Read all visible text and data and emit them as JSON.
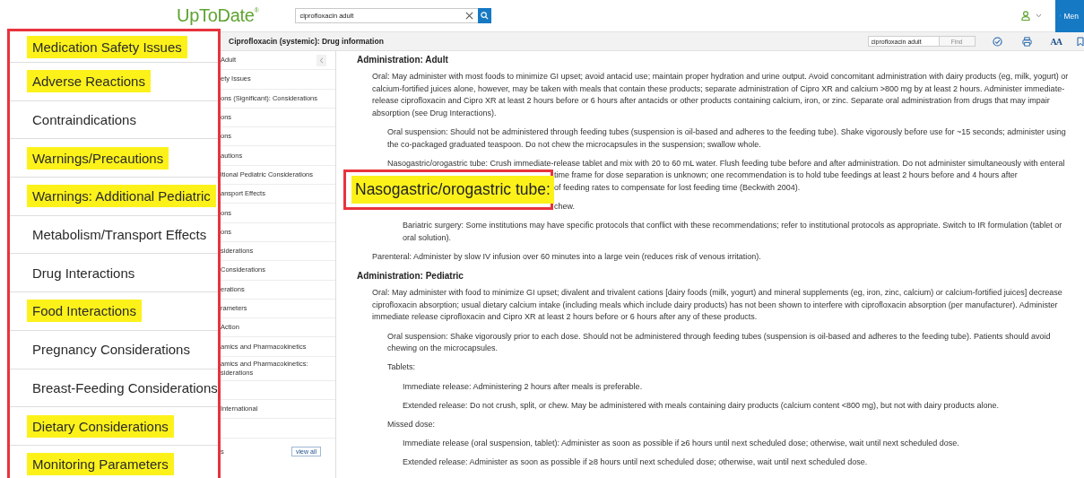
{
  "header": {
    "logo": "UpToDate",
    "logo_mark": "®",
    "search": {
      "value": "ciprofloxacin adult"
    },
    "menu_label": "Men"
  },
  "title_bar": {
    "title": "Ciprofloxacin (systemic): Drug information",
    "find_field": {
      "value": "ciprofloxacin adult"
    },
    "find_button": "Find",
    "font_button": "AA"
  },
  "sidebar": {
    "items": [
      {
        "kind": "link",
        "label": "Adult"
      },
      {
        "kind": "link",
        "label": "ety Issues"
      },
      {
        "kind": "link",
        "label": "ons (Significant): Considerations"
      },
      {
        "kind": "link",
        "label": "ons"
      },
      {
        "kind": "link",
        "label": "ons"
      },
      {
        "kind": "link",
        "label": "autions"
      },
      {
        "kind": "link",
        "label": "itional Pediatric Considerations"
      },
      {
        "kind": "link",
        "label": "ansport Effects"
      },
      {
        "kind": "link",
        "label": "ons"
      },
      {
        "kind": "link",
        "label": "ons"
      },
      {
        "kind": "link",
        "label": "siderations"
      },
      {
        "kind": "link",
        "label": "Considerations"
      },
      {
        "kind": "link",
        "label": "erations"
      },
      {
        "kind": "link",
        "label": "rameters"
      },
      {
        "kind": "link",
        "label": "Action"
      },
      {
        "kind": "link",
        "label": "amics and Pharmacokinetics"
      },
      {
        "kind": "link",
        "label": "amics and Pharmacokinetics: siderations"
      },
      {
        "kind": "blank"
      },
      {
        "kind": "link",
        "label": "International"
      },
      {
        "kind": "blank"
      }
    ],
    "footer_label": "s",
    "view_all": "view all"
  },
  "overlay": {
    "items": [
      {
        "label": "Medication Safety Issues",
        "highlighted": true
      },
      {
        "label": "Adverse Reactions",
        "highlighted": true
      },
      {
        "label": "Contraindications",
        "highlighted": false
      },
      {
        "label": "Warnings/Precautions",
        "highlighted": true
      },
      {
        "label": "Warnings: Additional Pediatric",
        "highlighted": true
      },
      {
        "label": "Metabolism/Transport Effects",
        "highlighted": false
      },
      {
        "label": "Drug Interactions",
        "highlighted": false
      },
      {
        "label": "Food Interactions",
        "highlighted": true
      },
      {
        "label": "Pregnancy Considerations",
        "highlighted": false
      },
      {
        "label": "Breast-Feeding Considerations",
        "highlighted": false
      },
      {
        "label": "Dietary Considerations",
        "highlighted": true
      },
      {
        "label": "Monitoring Parameters",
        "highlighted": true
      }
    ]
  },
  "callout": {
    "label": "Nasogastric/orogastric tube:"
  },
  "content": {
    "sections": [
      {
        "heading": "Administration: Adult",
        "nodes": [
          {
            "kind": "text",
            "text": "Oral: May administer with most foods to minimize GI upset; avoid antacid use; maintain proper hydration and urine output. Avoid concomitant administration with dairy products (eg, milk, yogurt) or calcium-fortified juices alone, however, may be taken with meals that contain these products; separate administration of Cipro XR and calcium >800 mg by at least 2 hours. Administer immediate-release ciprofloxacin and Cipro XR at least 2 hours before or 6 hours after antacids or other products containing calcium, iron, or zinc. Separate oral administration from drugs that may impair absorption (see Drug Interactions).",
            "children": [
              {
                "kind": "text",
                "text": "Oral suspension: Should not be administered through feeding tubes (suspension is oil-based and adheres to the feeding tube). Shake vigorously before use for ~15 seconds; administer using the co-packaged graduated teaspoon. Do not chew the microcapsules in the suspension; swallow whole."
              },
              {
                "kind": "lines",
                "lines": [
                  {
                    "text": "Nasogastric/orogastric tube: Crush immediate-release tablet and mix with 20 to 60 mL water. Flush feeding tube before and after administration. Do not administer simultaneously with enteral",
                    "covered": false
                  },
                  {
                    "text": "time frame for dose separation is unknown; one recommendation is to hold tube feedings at least 2 hours before and 4 hours after",
                    "covered": true
                  },
                  {
                    "text": "of feeding rates to compensate for lost feeding time (Beckwith 2004).",
                    "covered": true
                  }
                ]
              },
              {
                "kind": "lines",
                "lines": [
                  {
                    "text": "chew.",
                    "covered": true
                  }
                ],
                "children": [
                  {
                    "kind": "text",
                    "text": "Bariatric surgery: Some institutions may have specific protocols that conflict with these recommendations; refer to institutional protocols as appropriate. Switch to IR formulation (tablet or oral solution)."
                  }
                ]
              }
            ]
          },
          {
            "kind": "text",
            "text": "Parenteral: Administer by slow IV infusion over 60 minutes into a large vein (reduces risk of venous irritation)."
          }
        ]
      },
      {
        "heading": "Administration: Pediatric",
        "nodes": [
          {
            "kind": "text",
            "text": "Oral: May administer with food to minimize GI upset; divalent and trivalent cations [dairy foods (milk, yogurt) and mineral supplements (eg, iron, zinc, calcium) or calcium-fortified juices] decrease ciprofloxacin absorption; usual dietary calcium intake (including meals which include dairy products) has not been shown to interfere with ciprofloxacin absorption (per manufacturer). Administer immediate release ciprofloxacin and Cipro XR at least 2 hours before or 6 hours after any of these products.",
            "children": [
              {
                "kind": "text",
                "text": "Oral suspension: Shake vigorously prior to each dose. Should not be administered through feeding tubes (suspension is oil-based and adheres to the feeding tube). Patients should avoid chewing on the microcapsules."
              },
              {
                "kind": "text",
                "text": "Tablets:",
                "children": [
                  {
                    "kind": "text",
                    "text": "Immediate release: Administering 2 hours after meals is preferable."
                  },
                  {
                    "kind": "text",
                    "text": "Extended release: Do not crush, split, or chew. May be administered with meals containing dairy products (calcium content <800 mg), but not with dairy products alone."
                  }
                ]
              },
              {
                "kind": "text",
                "text": "Missed dose:",
                "children": [
                  {
                    "kind": "text",
                    "text": "Immediate release (oral suspension, tablet): Administer as soon as possible if ≥6 hours until next scheduled dose; otherwise, wait until next scheduled dose."
                  },
                  {
                    "kind": "text",
                    "text": "Extended release: Administer as soon as possible if ≥8 hours until next scheduled dose; otherwise, wait until next scheduled dose."
                  }
                ]
              }
            ]
          }
        ]
      }
    ]
  }
}
